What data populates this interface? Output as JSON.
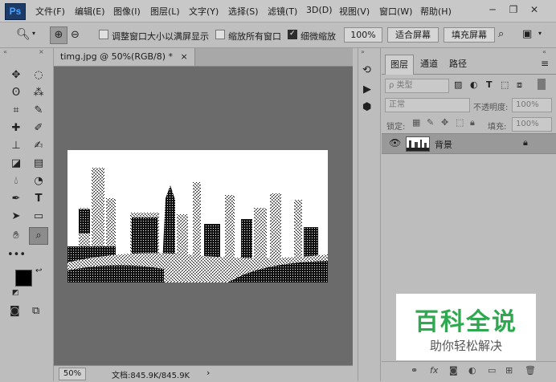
{
  "app": {
    "logo": "Ps"
  },
  "menu": [
    "文件(F)",
    "编辑(E)",
    "图像(I)",
    "图层(L)",
    "文字(Y)",
    "选择(S)",
    "滤镜(T)",
    "3D(D)",
    "视图(V)",
    "窗口(W)",
    "帮助(H)"
  ],
  "window_controls": {
    "minimize": "─",
    "restore": "❐",
    "close": "✕"
  },
  "options": {
    "resize_windows": "调整窗口大小以满屏显示",
    "zoom_all_windows": "缩放所有窗口",
    "scrubby_zoom": "细微缩放",
    "zoom_level": "100%",
    "fit_screen": "适合屏幕",
    "fill_screen": "填充屏幕"
  },
  "document": {
    "tab_title": "timg.jpg @ 50%(RGB/8) *",
    "tab_close": "×",
    "status_zoom": "50%",
    "status_info": "文档:845.9K/845.9K",
    "status_arrow": "›"
  },
  "layers_panel": {
    "tabs": [
      "图层",
      "通道",
      "路径"
    ],
    "filter_placeholder": "ρ 类型",
    "blend_mode": "正常",
    "opacity_label": "不透明度:",
    "opacity_value": "100%",
    "lock_label": "锁定:",
    "fill_label": "填充:",
    "fill_value": "100%",
    "layers": [
      {
        "name": "背景"
      }
    ]
  },
  "watermark": {
    "title": "百科全说",
    "subtitle": "助你轻松解决"
  },
  "colors": {
    "accent_green": "#2fa84f",
    "ps_blue": "#1c3b69"
  }
}
